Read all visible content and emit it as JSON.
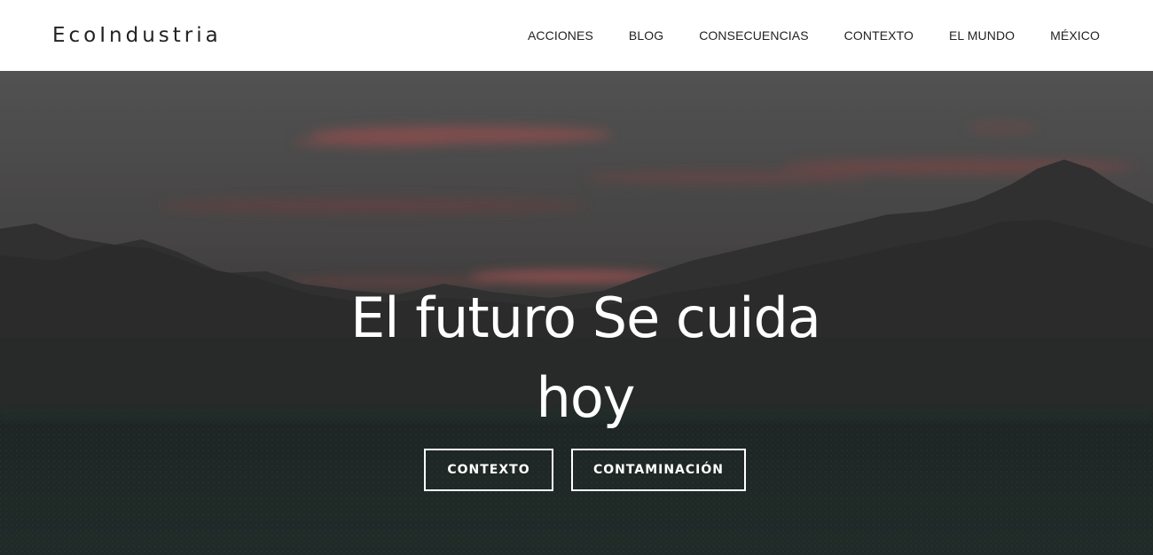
{
  "brand": {
    "name": "EcoIndustria"
  },
  "nav": {
    "items": [
      {
        "label": "ACCIONES"
      },
      {
        "label": "BLOG"
      },
      {
        "label": "CONSECUENCIAS"
      },
      {
        "label": "CONTEXTO"
      },
      {
        "label": "EL MUNDO"
      },
      {
        "label": "MÉXICO"
      }
    ]
  },
  "hero": {
    "title": "El futuro Se cuida hoy",
    "background_image": "mountain-sunset-landscape",
    "buttons": [
      {
        "label": "CONTEXTO"
      },
      {
        "label": "CONTAMINACIÓN"
      }
    ]
  },
  "colors": {
    "header_bg": "#ffffff",
    "text_dark": "#222222",
    "hero_text": "#ffffff",
    "sky_top": "#5e5e5e",
    "sunset_accent": "#b85f5f",
    "mountains": "#2e2f30",
    "field": "#1e2a27"
  }
}
